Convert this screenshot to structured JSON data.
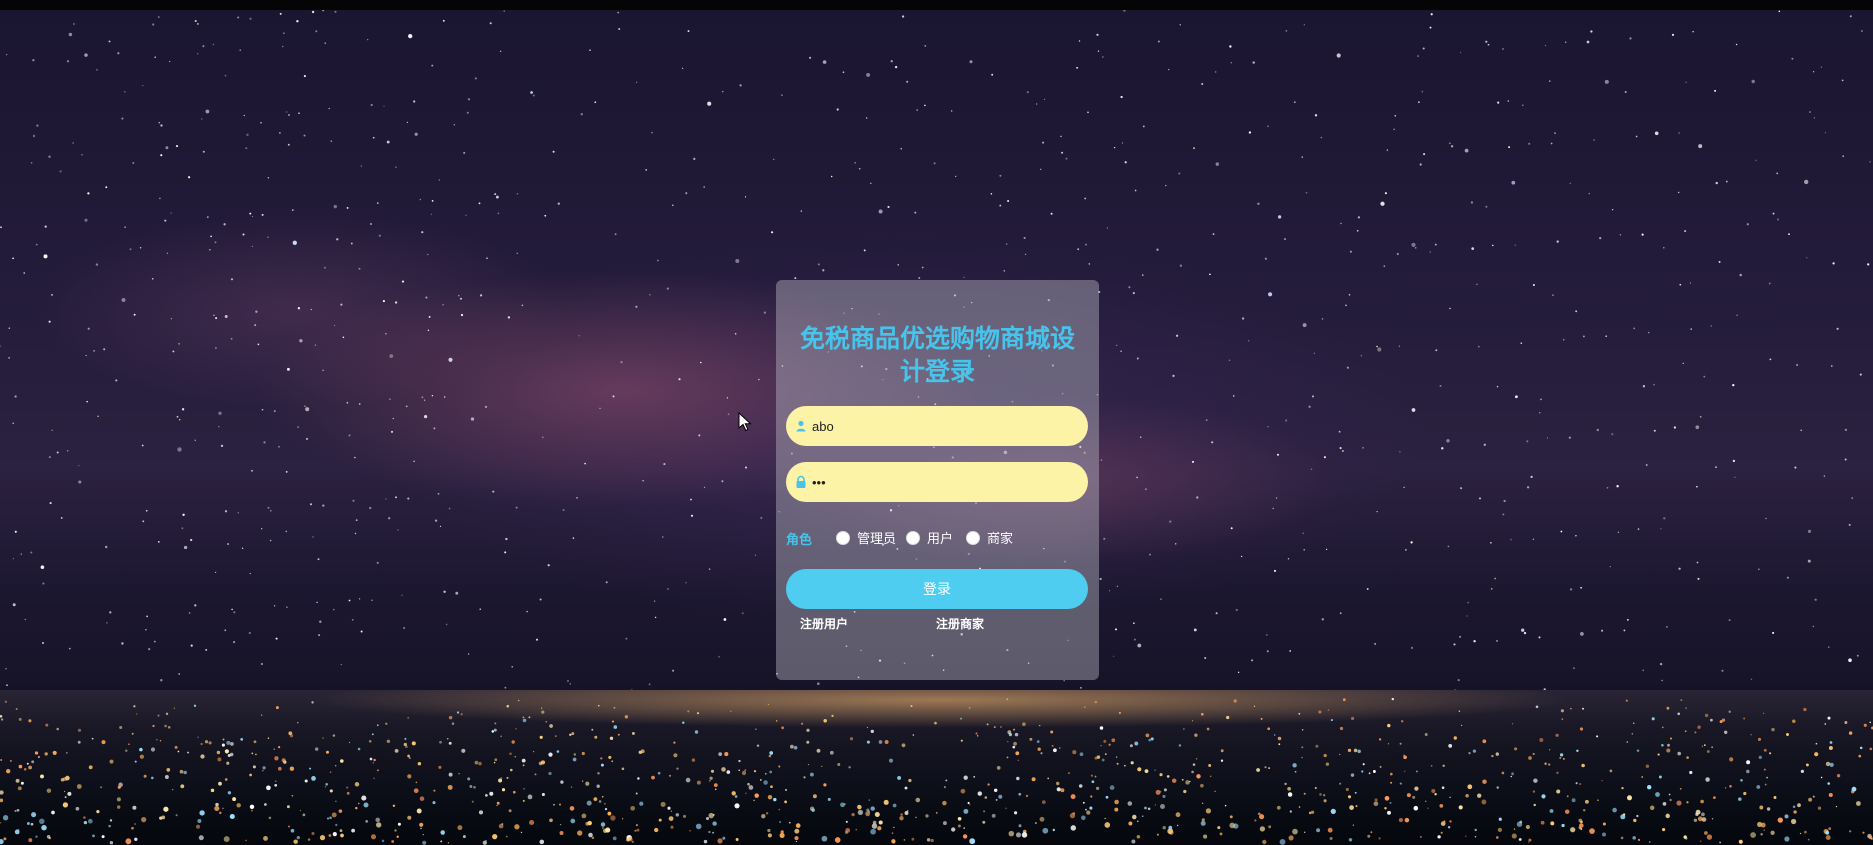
{
  "login": {
    "title": "免税商品优选购物商城设计登录",
    "username_value": "abo",
    "password_value": "abc",
    "role_label": "角色",
    "roles": [
      "管理员",
      "用户",
      "商家"
    ],
    "login_button": "登录",
    "register_user": "注册用户",
    "register_merchant": "注册商家"
  },
  "colors": {
    "accent": "#46c4ec",
    "button": "#4fcdf0",
    "input_bg": "#fdf3a6"
  },
  "icons": [
    "user-icon",
    "lock-icon",
    "mouse-cursor-icon"
  ]
}
